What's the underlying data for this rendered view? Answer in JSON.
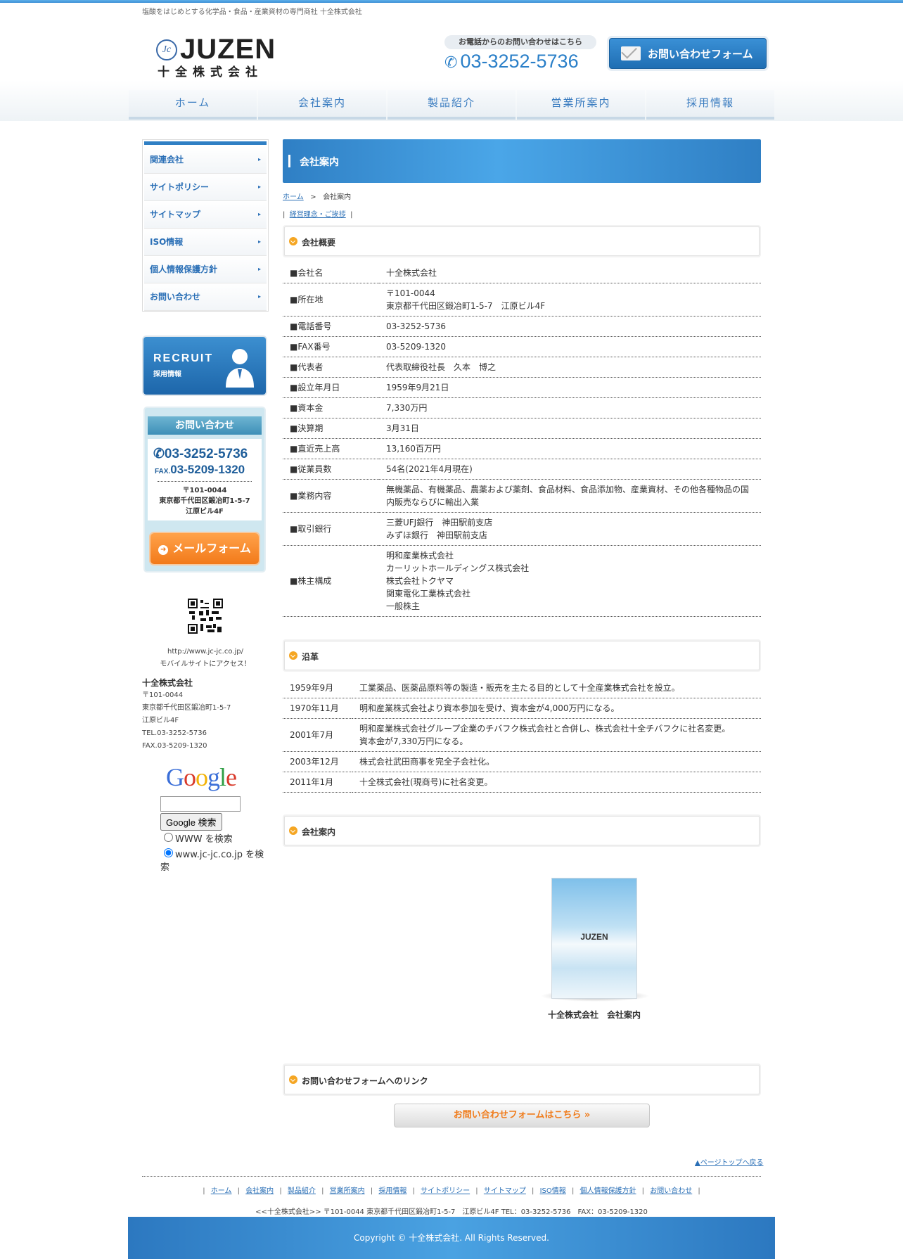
{
  "tagline": "塩酸をはじめとする化学品・食品・産業資材の専門商社 十全株式会社",
  "logo": {
    "mark": "Jc",
    "brand": "JUZEN",
    "kanji": "十全株式会社"
  },
  "header_tel": {
    "caption": "お電話からのお問い合わせはこちら",
    "number": "03-3252-5736"
  },
  "header_contact_button": "お問い合わせフォーム",
  "gnav": [
    "ホーム",
    "会社案内",
    "製品紹介",
    "営業所案内",
    "採用情報"
  ],
  "side_menu": [
    "関連会社",
    "サイトポリシー",
    "サイトマップ",
    "ISO情報",
    "個人情報保護方針",
    "お問い合わせ"
  ],
  "recruit": {
    "title": "RECRUIT",
    "sub": "採用情報"
  },
  "contact_side": {
    "head": "お問い合わせ",
    "tel": "03-3252-5736",
    "fax_label": "FAX.",
    "fax": "03-5209-1320",
    "addr1": "〒101-0044",
    "addr2": "東京都千代田区鍛冶町1-5-7",
    "addr3": "江原ビル4F",
    "mail_button": "メールフォーム"
  },
  "mobile": {
    "url": "http://www.jc-jc.co.jp/",
    "note": "モバイルサイトにアクセス！"
  },
  "side_company": {
    "name": "十全株式会社",
    "lines": [
      "〒101-0044",
      "東京都千代田区鍛冶町1-5-7",
      "江原ビル4F",
      "TEL.03-3252-5736",
      "FAX.03-5209-1320"
    ]
  },
  "google": {
    "logo": "Google",
    "button": "Google 検索",
    "opt_www": "WWW を検索",
    "opt_site": "www.jc-jc.co.jp を検索",
    "input_value": ""
  },
  "page_title": "会社案内",
  "breadcrumb": {
    "home": "ホーム",
    "sep": ">",
    "current": "会社案内"
  },
  "sublink": "経営理念・ご挨拶",
  "sections": {
    "overview": "会社概要",
    "history": "沿革",
    "brochure": "会社案内",
    "form_link": "お問い合わせフォームへのリンク"
  },
  "overview_rows": [
    {
      "k": "■会社名",
      "v": [
        "十全株式会社"
      ]
    },
    {
      "k": "■所在地",
      "v": [
        "〒101-0044",
        "東京都千代田区鍛冶町1-5-7　江原ビル4F"
      ]
    },
    {
      "k": "■電話番号",
      "v": [
        "03-3252-5736"
      ]
    },
    {
      "k": "■FAX番号",
      "v": [
        "03-5209-1320"
      ]
    },
    {
      "k": "■代表者",
      "v": [
        "代表取締役社長　久本　博之"
      ]
    },
    {
      "k": "■設立年月日",
      "v": [
        "1959年9月21日"
      ]
    },
    {
      "k": "■資本金",
      "v": [
        "7,330万円"
      ]
    },
    {
      "k": "■決算期",
      "v": [
        "3月31日"
      ]
    },
    {
      "k": "■直近売上高",
      "v": [
        "13,160百万円"
      ]
    },
    {
      "k": "■従業員数",
      "v": [
        "54名(2021年4月現在)"
      ]
    },
    {
      "k": "■業務内容",
      "v": [
        "無機薬品、有機薬品、農薬および薬剤、食品材料、食品添加物、産業資材、その他各種物品の国",
        "内販売ならびに輸出入業"
      ]
    },
    {
      "k": "■取引銀行",
      "v": [
        "三菱UFJ銀行　神田駅前支店",
        "みずほ銀行　神田駅前支店"
      ]
    },
    {
      "k": "■株主構成",
      "v": [
        "明和産業株式会社",
        "カーリットホールディングス株式会社",
        "株式会社トクヤマ",
        "関東電化工業株式会社",
        "一般株主"
      ]
    }
  ],
  "history_rows": [
    {
      "k": "1959年9月",
      "v": [
        "工業薬品、医薬品原料等の製造・販売を主たる目的として十全産業株式会社を設立。"
      ]
    },
    {
      "k": "1970年11月",
      "v": [
        "明和産業株式会社より資本参加を受け、資本金が4,000万円になる。"
      ]
    },
    {
      "k": "2001年7月",
      "v": [
        "明和産業株式会社グループ企業のチバフク株式会社と合併し、株式会社十全チバフクに社名変更。",
        "資本金が7,330万円になる。"
      ]
    },
    {
      "k": "2003年12月",
      "v": [
        "株式会社武田商事を完全子会社化。"
      ]
    },
    {
      "k": "2011年1月",
      "v": [
        "十全株式会社(現商号)に社名変更。"
      ]
    }
  ],
  "brochure": {
    "cover_text": "JUZEN",
    "caption": "十全株式会社　会社案内"
  },
  "form_button": "お問い合わせフォームはこちら",
  "pagetop": "▲ページトップへ戻る",
  "footer_nav": [
    "ホーム",
    "会社案内",
    "製品紹介",
    "営業所案内",
    "採用情報",
    "サイトポリシー",
    "サイトマップ",
    "ISO情報",
    "個人情報保護方針",
    "お問い合わせ"
  ],
  "footer_addr": "<<十全株式会社>> 〒101-0044 東京都千代田区鍛冶町1-5-7　江原ビル4F TEL：03-3252-5736　FAX：03-5209-1320",
  "copyright": "Copyright © 十全株式会社. All Rights Reserved.",
  "colors": {
    "brand_blue": "#2f7fc4",
    "accent_orange": "#f27a1a",
    "link": "#2a6fb6"
  }
}
